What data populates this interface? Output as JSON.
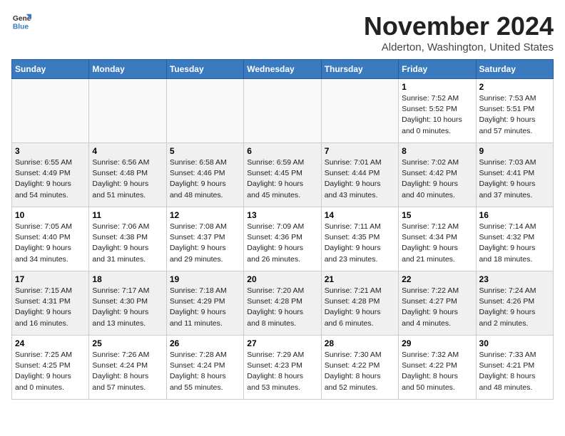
{
  "header": {
    "logo_general": "General",
    "logo_blue": "Blue",
    "month_title": "November 2024",
    "location": "Alderton, Washington, United States"
  },
  "weekdays": [
    "Sunday",
    "Monday",
    "Tuesday",
    "Wednesday",
    "Thursday",
    "Friday",
    "Saturday"
  ],
  "weeks": [
    [
      {
        "day": "",
        "info": ""
      },
      {
        "day": "",
        "info": ""
      },
      {
        "day": "",
        "info": ""
      },
      {
        "day": "",
        "info": ""
      },
      {
        "day": "",
        "info": ""
      },
      {
        "day": "1",
        "info": "Sunrise: 7:52 AM\nSunset: 5:52 PM\nDaylight: 10 hours\nand 0 minutes."
      },
      {
        "day": "2",
        "info": "Sunrise: 7:53 AM\nSunset: 5:51 PM\nDaylight: 9 hours\nand 57 minutes."
      }
    ],
    [
      {
        "day": "3",
        "info": "Sunrise: 6:55 AM\nSunset: 4:49 PM\nDaylight: 9 hours\nand 54 minutes."
      },
      {
        "day": "4",
        "info": "Sunrise: 6:56 AM\nSunset: 4:48 PM\nDaylight: 9 hours\nand 51 minutes."
      },
      {
        "day": "5",
        "info": "Sunrise: 6:58 AM\nSunset: 4:46 PM\nDaylight: 9 hours\nand 48 minutes."
      },
      {
        "day": "6",
        "info": "Sunrise: 6:59 AM\nSunset: 4:45 PM\nDaylight: 9 hours\nand 45 minutes."
      },
      {
        "day": "7",
        "info": "Sunrise: 7:01 AM\nSunset: 4:44 PM\nDaylight: 9 hours\nand 43 minutes."
      },
      {
        "day": "8",
        "info": "Sunrise: 7:02 AM\nSunset: 4:42 PM\nDaylight: 9 hours\nand 40 minutes."
      },
      {
        "day": "9",
        "info": "Sunrise: 7:03 AM\nSunset: 4:41 PM\nDaylight: 9 hours\nand 37 minutes."
      }
    ],
    [
      {
        "day": "10",
        "info": "Sunrise: 7:05 AM\nSunset: 4:40 PM\nDaylight: 9 hours\nand 34 minutes."
      },
      {
        "day": "11",
        "info": "Sunrise: 7:06 AM\nSunset: 4:38 PM\nDaylight: 9 hours\nand 31 minutes."
      },
      {
        "day": "12",
        "info": "Sunrise: 7:08 AM\nSunset: 4:37 PM\nDaylight: 9 hours\nand 29 minutes."
      },
      {
        "day": "13",
        "info": "Sunrise: 7:09 AM\nSunset: 4:36 PM\nDaylight: 9 hours\nand 26 minutes."
      },
      {
        "day": "14",
        "info": "Sunrise: 7:11 AM\nSunset: 4:35 PM\nDaylight: 9 hours\nand 23 minutes."
      },
      {
        "day": "15",
        "info": "Sunrise: 7:12 AM\nSunset: 4:34 PM\nDaylight: 9 hours\nand 21 minutes."
      },
      {
        "day": "16",
        "info": "Sunrise: 7:14 AM\nSunset: 4:32 PM\nDaylight: 9 hours\nand 18 minutes."
      }
    ],
    [
      {
        "day": "17",
        "info": "Sunrise: 7:15 AM\nSunset: 4:31 PM\nDaylight: 9 hours\nand 16 minutes."
      },
      {
        "day": "18",
        "info": "Sunrise: 7:17 AM\nSunset: 4:30 PM\nDaylight: 9 hours\nand 13 minutes."
      },
      {
        "day": "19",
        "info": "Sunrise: 7:18 AM\nSunset: 4:29 PM\nDaylight: 9 hours\nand 11 minutes."
      },
      {
        "day": "20",
        "info": "Sunrise: 7:20 AM\nSunset: 4:28 PM\nDaylight: 9 hours\nand 8 minutes."
      },
      {
        "day": "21",
        "info": "Sunrise: 7:21 AM\nSunset: 4:28 PM\nDaylight: 9 hours\nand 6 minutes."
      },
      {
        "day": "22",
        "info": "Sunrise: 7:22 AM\nSunset: 4:27 PM\nDaylight: 9 hours\nand 4 minutes."
      },
      {
        "day": "23",
        "info": "Sunrise: 7:24 AM\nSunset: 4:26 PM\nDaylight: 9 hours\nand 2 minutes."
      }
    ],
    [
      {
        "day": "24",
        "info": "Sunrise: 7:25 AM\nSunset: 4:25 PM\nDaylight: 9 hours\nand 0 minutes."
      },
      {
        "day": "25",
        "info": "Sunrise: 7:26 AM\nSunset: 4:24 PM\nDaylight: 8 hours\nand 57 minutes."
      },
      {
        "day": "26",
        "info": "Sunrise: 7:28 AM\nSunset: 4:24 PM\nDaylight: 8 hours\nand 55 minutes."
      },
      {
        "day": "27",
        "info": "Sunrise: 7:29 AM\nSunset: 4:23 PM\nDaylight: 8 hours\nand 53 minutes."
      },
      {
        "day": "28",
        "info": "Sunrise: 7:30 AM\nSunset: 4:22 PM\nDaylight: 8 hours\nand 52 minutes."
      },
      {
        "day": "29",
        "info": "Sunrise: 7:32 AM\nSunset: 4:22 PM\nDaylight: 8 hours\nand 50 minutes."
      },
      {
        "day": "30",
        "info": "Sunrise: 7:33 AM\nSunset: 4:21 PM\nDaylight: 8 hours\nand 48 minutes."
      }
    ]
  ]
}
